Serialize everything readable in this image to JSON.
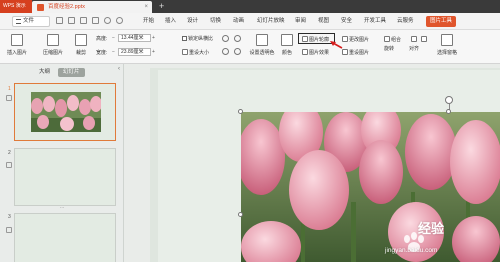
{
  "titlebar": {
    "app_name": "WPS 演示",
    "doc_name": "百度经验2.pptx",
    "close_glyph": "×",
    "new_tab_glyph": "+"
  },
  "menubar": {
    "file_label": "文件",
    "items": [
      "开始",
      "插入",
      "设计",
      "切换",
      "动画",
      "幻灯片放映",
      "审阅",
      "视图",
      "安全",
      "开发工具",
      "云服务",
      "图片工具"
    ],
    "active_index": 11,
    "active_color": "#e0552c"
  },
  "ribbon": {
    "insert_image": "插入图片",
    "compress_image": "压缩图片",
    "crop": "裁剪",
    "height_label": "高度:",
    "height_value": "13.44厘米",
    "width_label": "宽度:",
    "width_value": "23.89厘米",
    "lock_ratio": "锁定纵横比",
    "reset_size": "重设大小",
    "set_transparent": "设置透明色",
    "color": "颜色",
    "image_outline": "图片轮廓",
    "image_effect": "图片效果",
    "change_image": "更改图片",
    "reset_image": "重设图片",
    "combine": "组合",
    "rotate": "旋转",
    "align": "对齐",
    "selection_pane": "选择窗格",
    "stepper_minus": "−",
    "stepper_plus": "+"
  },
  "left_panel": {
    "tabs": [
      "大纲",
      "幻灯片"
    ],
    "active_tab": 1,
    "slides": [
      {
        "number": "1",
        "has_image": true
      },
      {
        "number": "2",
        "has_image": false
      },
      {
        "number": "3",
        "has_image": false
      }
    ],
    "collapse_glyph": "‹"
  },
  "watermark": {
    "brand": "经验",
    "url": "jingyan.baidu.com"
  }
}
